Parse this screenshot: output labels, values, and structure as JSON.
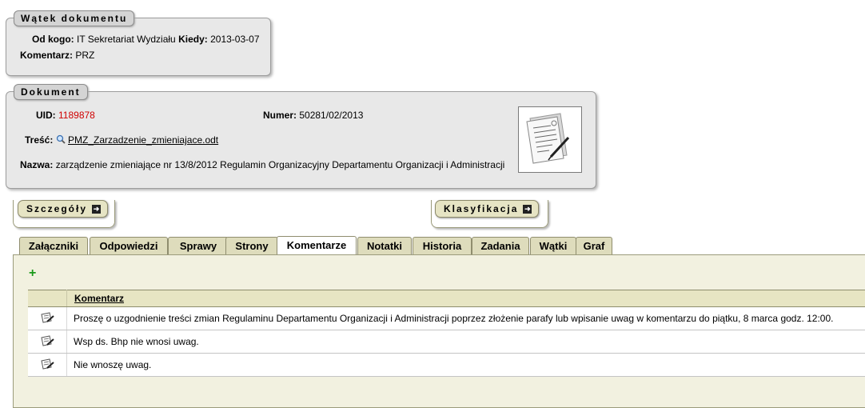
{
  "thread": {
    "legend": "Wątek dokumentu",
    "from_label": "Od kogo:",
    "from_value": "IT Sekretariat Wydziału",
    "when_label": "Kiedy:",
    "when_value": "2013-03-07",
    "comment_label": "Komentarz:",
    "comment_value": "PRZ"
  },
  "document": {
    "legend": "Dokument",
    "uid_label": "UID:",
    "uid_value": "1189878",
    "number_label": "Numer:",
    "number_value": "50281/02/2013",
    "content_label": "Treść:",
    "content_file": "PMZ_Zarzadzenie_zmieniajace.odt",
    "name_label": "Nazwa:",
    "name_value": "zarządzenie zmieniające nr 13/8/2012 Regulamin Organizacyjny Departamentu Organizacji i Administracji"
  },
  "toggles": {
    "details": "Szczegóły",
    "classification": "Klasyfikacja"
  },
  "tabs": [
    {
      "label": "Załączniki"
    },
    {
      "label": "Odpowiedzi"
    },
    {
      "label": "Sprawy"
    },
    {
      "label": "Strony"
    },
    {
      "label": "Komentarze"
    },
    {
      "label": "Notatki"
    },
    {
      "label": "Historia"
    },
    {
      "label": "Zadania"
    },
    {
      "label": "Wątki"
    },
    {
      "label": "Graf"
    }
  ],
  "active_tab": "Komentarze",
  "comments": {
    "add": "+",
    "header": "Komentarz",
    "rows": [
      {
        "text": "Proszę o uzgodnienie treści zmian Regulaminu Departamentu Organizacji i Administracji poprzez złożenie parafy lub wpisanie uwag w komentarzu do piątku, 8 marca godz. 12:00."
      },
      {
        "text": "Wsp ds. Bhp nie wnosi uwag."
      },
      {
        "text": "Nie wnoszę uwag."
      }
    ]
  },
  "colors": {
    "uid": "#d00000",
    "add": "#1a9a1a",
    "tab_bg": "#dedcbc",
    "panel_bg": "#e8e8e8"
  }
}
